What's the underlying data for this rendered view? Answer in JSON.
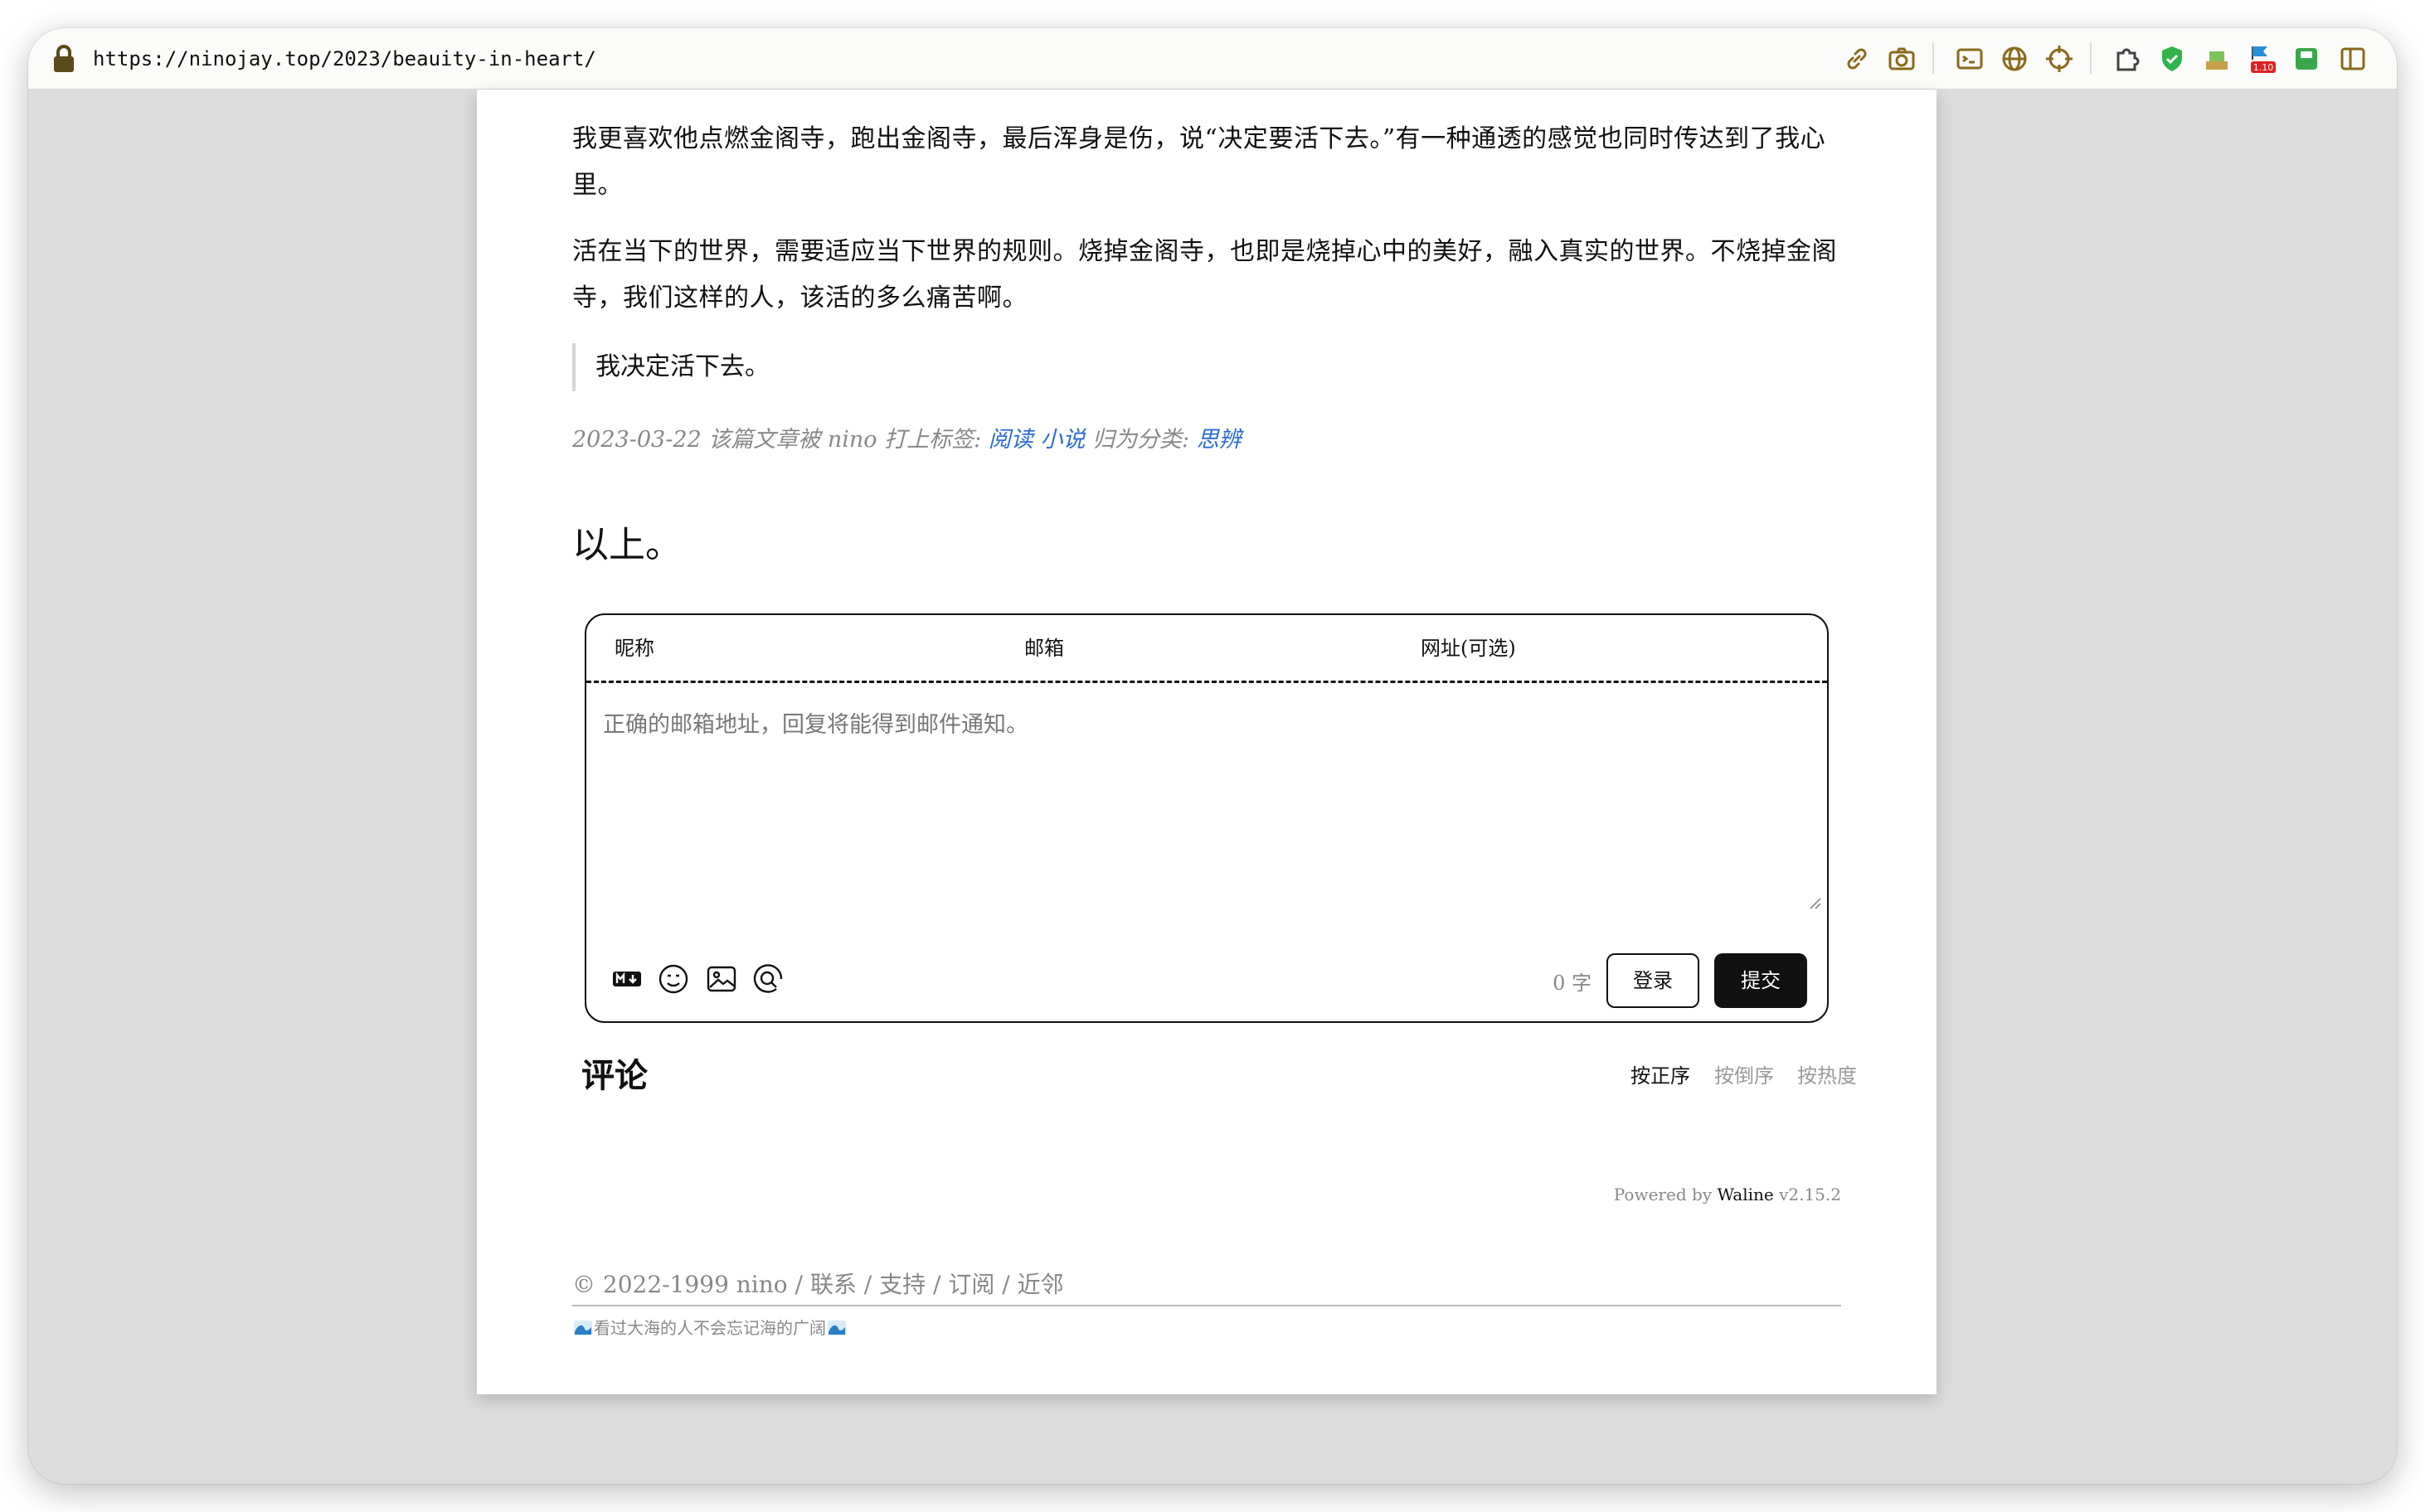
{
  "browser": {
    "url": "https://ninojay.top/2023/beauity-in-heart/",
    "badge_text": "1.10"
  },
  "article": {
    "paragraphs": [
      "我更喜欢他点燃金阁寺，跑出金阁寺，最后浑身是伤，说“决定要活下去。”有一种通透的感觉也同时传达到了我心里。",
      "活在当下的世界，需要适应当下世界的规则。烧掉金阁寺，也即是烧掉心中的美好，融入真实的世界。不烧掉金阁寺，我们这样的人，该活的多么痛苦啊。"
    ],
    "quote": "我决定活下去。",
    "meta": {
      "date": "2023-03-22",
      "tagged_text": "该篇文章被 nino 打上标签:",
      "tags": [
        "阅读",
        "小说"
      ],
      "category_text": "归为分类:",
      "category": "思辨"
    },
    "closing": "以上。"
  },
  "comment_form": {
    "nick_placeholder": "昵称",
    "mail_placeholder": "邮箱",
    "link_placeholder": "网址(可选)",
    "textarea_placeholder": "正确的邮箱地址，回复将能得到邮件通知。",
    "char_count": "0 字",
    "login_label": "登录",
    "submit_label": "提交"
  },
  "comments": {
    "title": "评论",
    "sort_options": [
      "按正序",
      "按倒序",
      "按热度"
    ],
    "active_sort": "按正序",
    "powered_prefix": "Powered by",
    "powered_brand": "Waline",
    "powered_version": "v2.15.2"
  },
  "footer": {
    "links_text": "© 2022-1999 nino / 联系 / 支持 / 订阅 / 近邻",
    "motto": "看过大海的人不会忘记海的广阔"
  },
  "colors": {
    "link": "#2a6bd6",
    "text": "#111111",
    "muted": "#888888"
  }
}
